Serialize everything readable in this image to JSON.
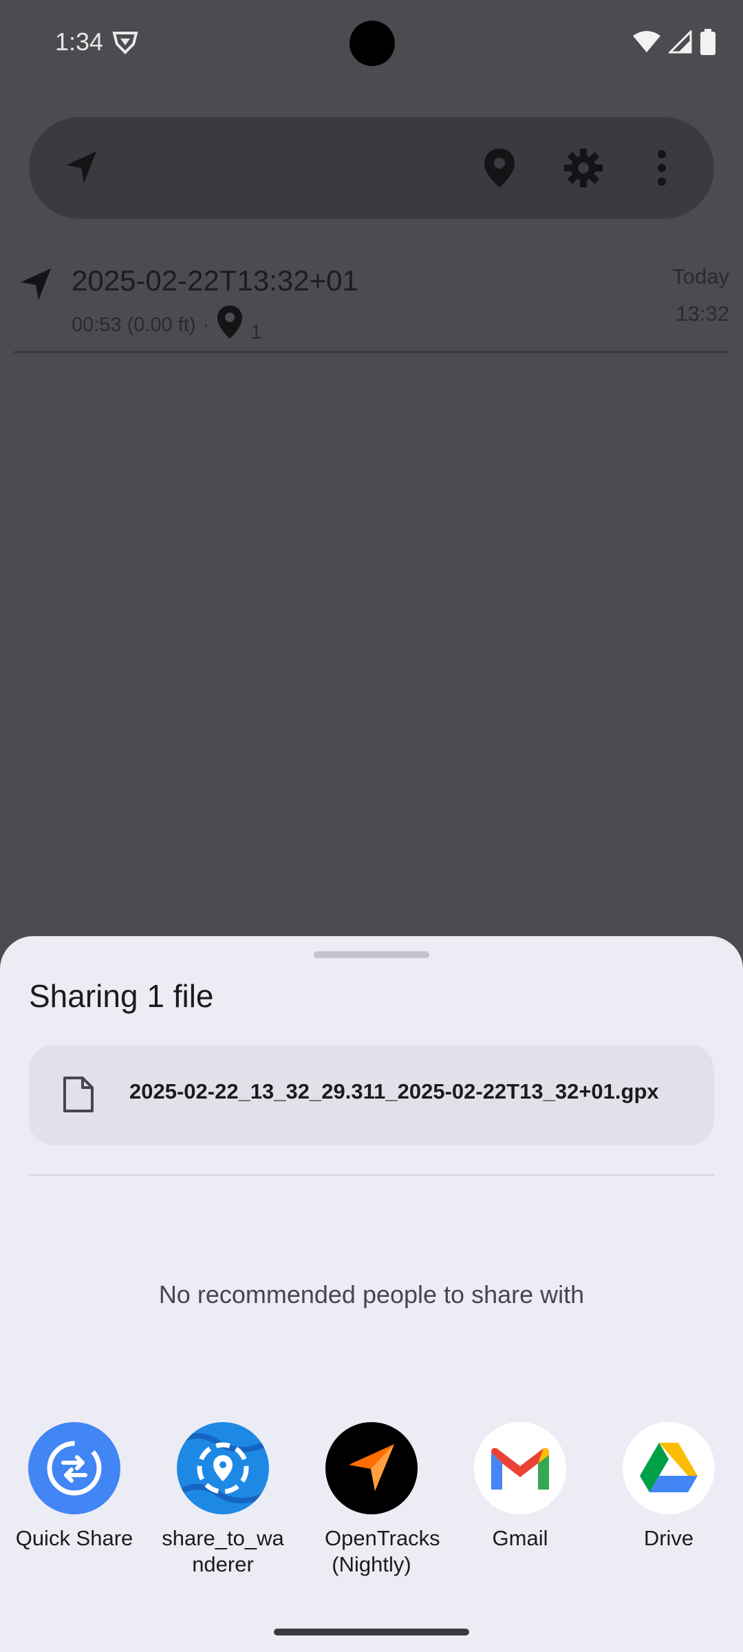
{
  "status_bar": {
    "time": "1:34"
  },
  "toolbar": {
    "icons": [
      "navigation-arrow-icon",
      "marker-icon",
      "settings-gear-icon",
      "more-vert-icon"
    ]
  },
  "track": {
    "title": "2025-02-22T13:32+01",
    "duration_distance": "00:53 (0.00 ft)",
    "separator": "·",
    "marker_count": "1",
    "date": "Today",
    "time": "13:32"
  },
  "share_sheet": {
    "title": "Sharing 1 file",
    "file_name": "2025-02-22_13_32_29.311_2025-02-22T13_32+01.gpx",
    "no_people_message": "No recommended people to share with",
    "apps": [
      {
        "label": "Quick Share",
        "icon": "quick-share-icon",
        "color": "#4285f4"
      },
      {
        "label": "share_to_wanderer",
        "icon": "wanderer-icon",
        "color": "#1e88e5"
      },
      {
        "label": "OpenTracks (Nightly)",
        "icon": "opentracks-icon",
        "color": "#000000"
      },
      {
        "label": "Gmail",
        "icon": "gmail-icon",
        "color": "#ffffff"
      },
      {
        "label": "Drive",
        "icon": "drive-icon",
        "color": "#ffffff"
      }
    ]
  },
  "colors": {
    "scrim_background": "#4c4b50",
    "sheet_background": "#ececf4",
    "accent_orange": "#ff6d00"
  }
}
